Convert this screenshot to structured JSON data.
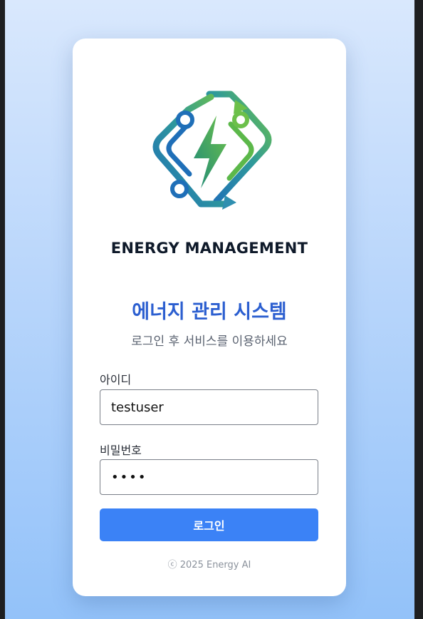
{
  "logo": {
    "brand_text": "ENERGY MANAGEMENT",
    "icon": "energy-lightning-cycle-icon",
    "colors": {
      "blue": "#1f6fb8",
      "green": "#6cc04a"
    }
  },
  "login": {
    "title": "에너지 관리 시스템",
    "subtitle": "로그인 후 서비스를 이용하세요",
    "id_label": "아이디",
    "id_value": "testuser",
    "password_label": "비밀번호",
    "password_value": "••••",
    "submit_label": "로그인",
    "footer": "ⓒ 2025 Energy AI"
  },
  "colors": {
    "accent": "#3b82f6",
    "title": "#2c5fd0"
  }
}
